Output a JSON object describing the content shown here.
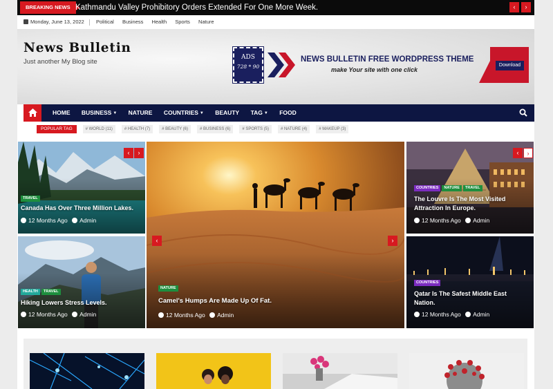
{
  "breaking": {
    "label": "BREAKING NEWS",
    "headline": "Kathmandu Valley Prohibitory Orders Extended For One More Week.",
    "prev": "‹",
    "next": "›"
  },
  "topbar": {
    "date": "Monday, June 13, 2022",
    "links": [
      "Political",
      "Business",
      "Health",
      "Sports",
      "Nature"
    ]
  },
  "site": {
    "title": "News Bulletin",
    "tagline": "Just another My Blog site"
  },
  "ad": {
    "stamp_line1": "ADS",
    "stamp_line2": "728 * 90",
    "title": "NEWS BULLETIN FREE WORDPRESS THEME",
    "subtitle": "make Your site with one click",
    "button": "Download"
  },
  "nav": {
    "items": [
      "HOME",
      "BUSINESS",
      "NATURE",
      "COUNTRIES",
      "BEAUTY",
      "TAG",
      "FOOD"
    ]
  },
  "popular_tags": {
    "label": "POPULAR TAG",
    "tags": [
      "# WORLD (11)",
      "# HEALTH (7)",
      "# BEAUTY (6)",
      "# BUSINESS (6)",
      "# SPORTS (5)",
      "# NATURE (4)",
      "# MAKEUP (3)"
    ]
  },
  "posts": {
    "left_top": {
      "categories": [
        "TRAVEL"
      ],
      "title": "Canada Has Over Three Million Lakes.",
      "date": "12 Months Ago",
      "author": "Admin"
    },
    "left_bottom": {
      "categories": [
        "HEALTH",
        "TRAVEL"
      ],
      "title": "Hiking Lowers Stress Levels.",
      "date": "12 Months Ago",
      "author": "Admin"
    },
    "center": {
      "categories": [
        "NATURE"
      ],
      "title": "Camel's Humps Are Made Up Of Fat.",
      "date": "12 Months Ago",
      "author": "Admin"
    },
    "right_top": {
      "categories": [
        "COUNTRIES",
        "NATURE",
        "TRAVEL"
      ],
      "title": "The Louvre Is The Most Visited Attraction In Europe.",
      "date": "12 Months Ago",
      "author": "Admin"
    },
    "right_bottom": {
      "categories": [
        "COUNTRIES"
      ],
      "title": "Qatar Is The Safest Middle East Nation.",
      "date": "12 Months Ago",
      "author": "Admin"
    }
  },
  "colors": {
    "accent_red": "#d71920",
    "nav_navy": "#0d1642",
    "cat_green": "#1e8e3e",
    "cat_purple": "#7b2cbf",
    "cat_teal": "#22a99a"
  },
  "icons": {
    "home": "home-icon",
    "search": "search-icon",
    "clock": "clock-icon",
    "user": "user-icon",
    "calendar": "calendar-icon"
  }
}
